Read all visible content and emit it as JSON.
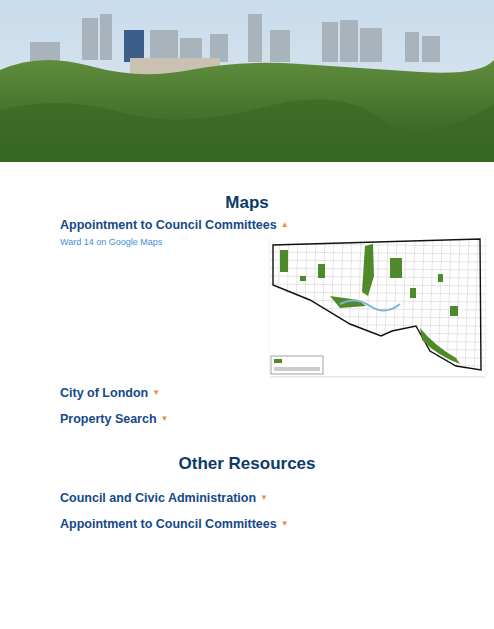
{
  "sections": [
    {
      "heading": "Maps",
      "accordions": [
        {
          "label": "Appointment to Council Committees",
          "icon": "▲",
          "expanded": true,
          "links": [
            "Ward 14 on Google Maps"
          ]
        },
        {
          "label": "City of London",
          "icon": "▼",
          "expanded": false,
          "links": []
        },
        {
          "label": "Property Search",
          "icon": "▼",
          "expanded": false,
          "links": []
        }
      ]
    },
    {
      "heading": "Other Resources",
      "accordions": [
        {
          "label": "Council and Civic Administration",
          "icon": "▼",
          "expanded": false,
          "links": []
        },
        {
          "label": "Appointment to Council Committees",
          "icon": "▼",
          "expanded": false,
          "links": []
        }
      ]
    }
  ]
}
